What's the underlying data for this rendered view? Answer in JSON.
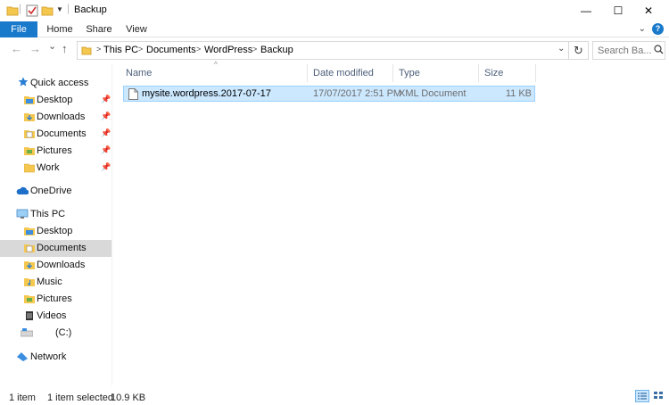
{
  "window": {
    "title": "Backup",
    "minimize_glyph": "—",
    "maximize_glyph": "☐",
    "close_glyph": "✕"
  },
  "ribbon": {
    "tabs": [
      "File",
      "Home",
      "Share",
      "View"
    ],
    "help": "?"
  },
  "nav": {
    "back": "←",
    "forward": "→",
    "recent": "⌄",
    "up": "↑"
  },
  "address": {
    "crumbs": [
      "This PC",
      "Documents",
      "WordPress",
      "Backup"
    ],
    "separator": ">"
  },
  "search": {
    "placeholder": "Search Ba..."
  },
  "sidebar": {
    "items": [
      {
        "label": "Quick access",
        "icon": "star-icon",
        "pinned": false
      },
      {
        "label": "Desktop",
        "icon": "desktop-folder-icon",
        "pinned": true
      },
      {
        "label": "Downloads",
        "icon": "downloads-folder-icon",
        "pinned": true
      },
      {
        "label": "Documents",
        "icon": "documents-folder-icon",
        "pinned": true
      },
      {
        "label": "Pictures",
        "icon": "pictures-folder-icon",
        "pinned": true
      },
      {
        "label": "Work",
        "icon": "folder-icon",
        "pinned": true
      },
      {
        "label": "OneDrive",
        "icon": "cloud-icon",
        "pinned": false
      },
      {
        "label": "This PC",
        "icon": "computer-icon",
        "pinned": false
      },
      {
        "label": "Desktop",
        "icon": "desktop-folder-icon",
        "pinned": false
      },
      {
        "label": "Documents",
        "icon": "documents-folder-icon",
        "pinned": false
      },
      {
        "label": "Downloads",
        "icon": "downloads-folder-icon",
        "pinned": false
      },
      {
        "label": "Music",
        "icon": "music-folder-icon",
        "pinned": false
      },
      {
        "label": "Pictures",
        "icon": "pictures-folder-icon",
        "pinned": false
      },
      {
        "label": "Videos",
        "icon": "videos-folder-icon",
        "pinned": false
      },
      {
        "label": "(C:)",
        "icon": "drive-icon",
        "pinned": false
      },
      {
        "label": "Network",
        "icon": "network-icon",
        "pinned": false
      }
    ],
    "selected_label": "Documents"
  },
  "columns": [
    "Name",
    "Date modified",
    "Type",
    "Size"
  ],
  "files": [
    {
      "name": "mysite.wordpress.2017-07-17",
      "date": "17/07/2017 2:51 PM",
      "type": "XML Document",
      "size": "11 KB",
      "selected": true
    }
  ],
  "status": {
    "count": "1 item",
    "selected": "1 item selected",
    "size": "10.9 KB"
  },
  "colors": {
    "accent": "#1979ca",
    "selection_bg": "#cce8ff",
    "selection_border": "#99d1ff",
    "nav_selected": "#d9d9d9",
    "folder_yellow": "#f4c74f"
  }
}
